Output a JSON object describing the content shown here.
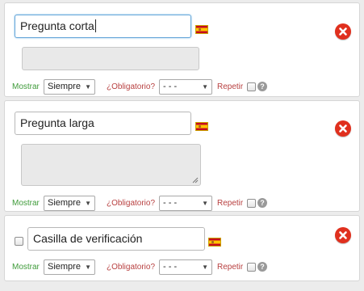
{
  "questions": [
    {
      "type_label": "Pregunta corta",
      "show_label": "Mostrar",
      "show_value": "Siempre",
      "required_label": "¿Obligatorio?",
      "required_value": "- - -",
      "repeat_label": "Repetir",
      "help_glyph": "?"
    },
    {
      "type_label": "Pregunta larga",
      "show_label": "Mostrar",
      "show_value": "Siempre",
      "required_label": "¿Obligatorio?",
      "required_value": "- - -",
      "repeat_label": "Repetir",
      "help_glyph": "?"
    },
    {
      "type_label": "Casilla de verificación",
      "show_label": "Mostrar",
      "show_value": "Siempre",
      "required_label": "¿Obligatorio?",
      "required_value": "- - -",
      "repeat_label": "Repetir",
      "help_glyph": "?"
    }
  ],
  "icons": {
    "flag": "spain-flag-icon",
    "delete": "delete-icon",
    "help": "help-icon",
    "dropdown": "chevron-down-icon"
  },
  "colors": {
    "delete": "#e0301e",
    "show_label": "#3f9b3a",
    "required_label": "#b84040",
    "focus_border": "#66a7d9"
  }
}
